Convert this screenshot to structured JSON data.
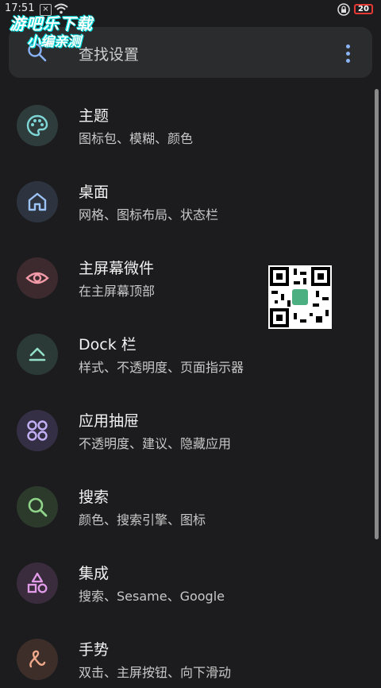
{
  "status_bar": {
    "time": "17:51",
    "battery": "20"
  },
  "watermark": {
    "line1": "游吧乐下载",
    "line2": "小编亲测"
  },
  "search": {
    "placeholder": "查找设置"
  },
  "items": [
    {
      "title": "主题",
      "subtitle": "图标包、模糊、颜色",
      "icon": "palette-icon",
      "bg": "#2e3c3c",
      "fg": "#7fd6d6"
    },
    {
      "title": "桌面",
      "subtitle": "网格、图标布局、状态栏",
      "icon": "home-icon",
      "bg": "#2d3440",
      "fg": "#9cc3f5"
    },
    {
      "title": "主屏幕微件",
      "subtitle": "在主屏幕顶部",
      "icon": "eye-icon",
      "bg": "#3d2a2e",
      "fg": "#f29aa8"
    },
    {
      "title": "Dock 栏",
      "subtitle": "样式、不透明度、页面指示器",
      "icon": "dock-icon",
      "bg": "#2b3a36",
      "fg": "#93e0c7"
    },
    {
      "title": "应用抽屉",
      "subtitle": "不透明度、建议、隐藏应用",
      "icon": "apps-grid-icon",
      "bg": "#342f45",
      "fg": "#c4b0f5"
    },
    {
      "title": "搜索",
      "subtitle": "颜色、搜索引擎、图标",
      "icon": "search-icon",
      "bg": "#2c3a2c",
      "fg": "#90d48a"
    },
    {
      "title": "集成",
      "subtitle": "搜索、Sesame、Google",
      "icon": "shapes-icon",
      "bg": "#3a2c3d",
      "fg": "#e19be8"
    },
    {
      "title": "手势",
      "subtitle": "双击、主屏按钮、向下滑动",
      "icon": "gesture-icon",
      "bg": "#3d2e2a",
      "fg": "#f0a98a"
    }
  ]
}
